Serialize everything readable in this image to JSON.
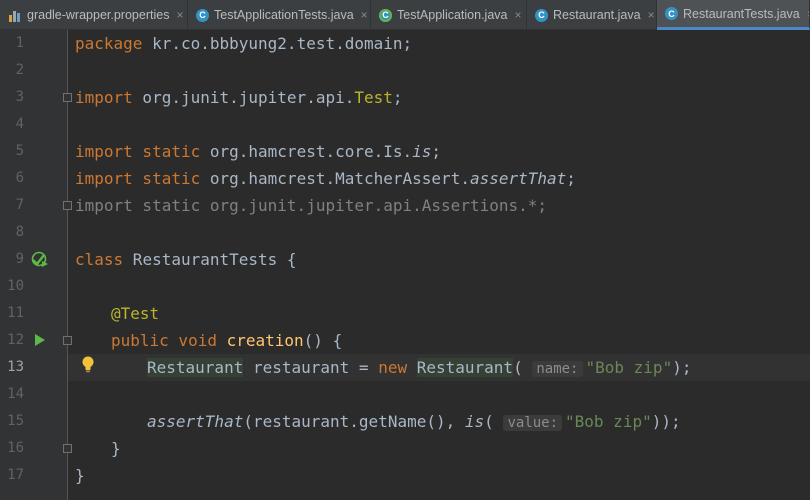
{
  "tabs": [
    {
      "label": "gradle-wrapper.properties",
      "close": "×",
      "icon": "properties-icon"
    },
    {
      "label": "TestApplicationTests.java",
      "close": "×",
      "icon": "class-icon",
      "glyph": "C"
    },
    {
      "label": "TestApplication.java",
      "close": "×",
      "icon": "spring-class-icon",
      "glyph": "C"
    },
    {
      "label": "Restaurant.java",
      "close": "×",
      "icon": "class-icon",
      "glyph": "C"
    },
    {
      "label": "RestaurantTests.java",
      "close": "×",
      "icon": "class-icon",
      "glyph": "C",
      "active": true
    }
  ],
  "line_numbers": [
    "1",
    "2",
    "3",
    "4",
    "5",
    "6",
    "7",
    "8",
    "9",
    "10",
    "11",
    "12",
    "13",
    "14",
    "15",
    "16",
    "17"
  ],
  "current_line": "13",
  "code": {
    "l1": {
      "kw": "package",
      "rest": " kr.co.bbbyung2.test.domain;"
    },
    "l3": {
      "kw": "import",
      "pkg": " org.junit.jupiter.api.",
      "cls": "Test",
      "end": ";"
    },
    "l5": {
      "kw": "import static",
      "pkg": " org.hamcrest.core.Is.",
      "member": "is",
      "end": ";"
    },
    "l6": {
      "kw": "import static",
      "pkg": " org.hamcrest.MatcherAssert.",
      "member": "assertThat",
      "end": ";"
    },
    "l7": {
      "text": "import static org.junit.jupiter.api.Assertions.*;"
    },
    "l9": {
      "kw": "class",
      "rest": " RestaurantTests {"
    },
    "l11": {
      "ann": "@Test"
    },
    "l12": {
      "kw": "public void",
      "method": "creation",
      "rest": "() {"
    },
    "l13": {
      "type": "Restaurant",
      "var": " restaurant = ",
      "kw": "new",
      "ctor": "Restaurant",
      "open": "(",
      "hint": "name:",
      "str": "\"Bob zip\"",
      "end": ");"
    },
    "l15": {
      "method": "assertThat",
      "mid": "(restaurant.getName(), ",
      "method2": "is",
      "open": "(",
      "hint": "value:",
      "str": "\"Bob zip\"",
      "end": "));"
    },
    "l16": {
      "text": "}"
    },
    "l17": {
      "text": "}"
    }
  }
}
